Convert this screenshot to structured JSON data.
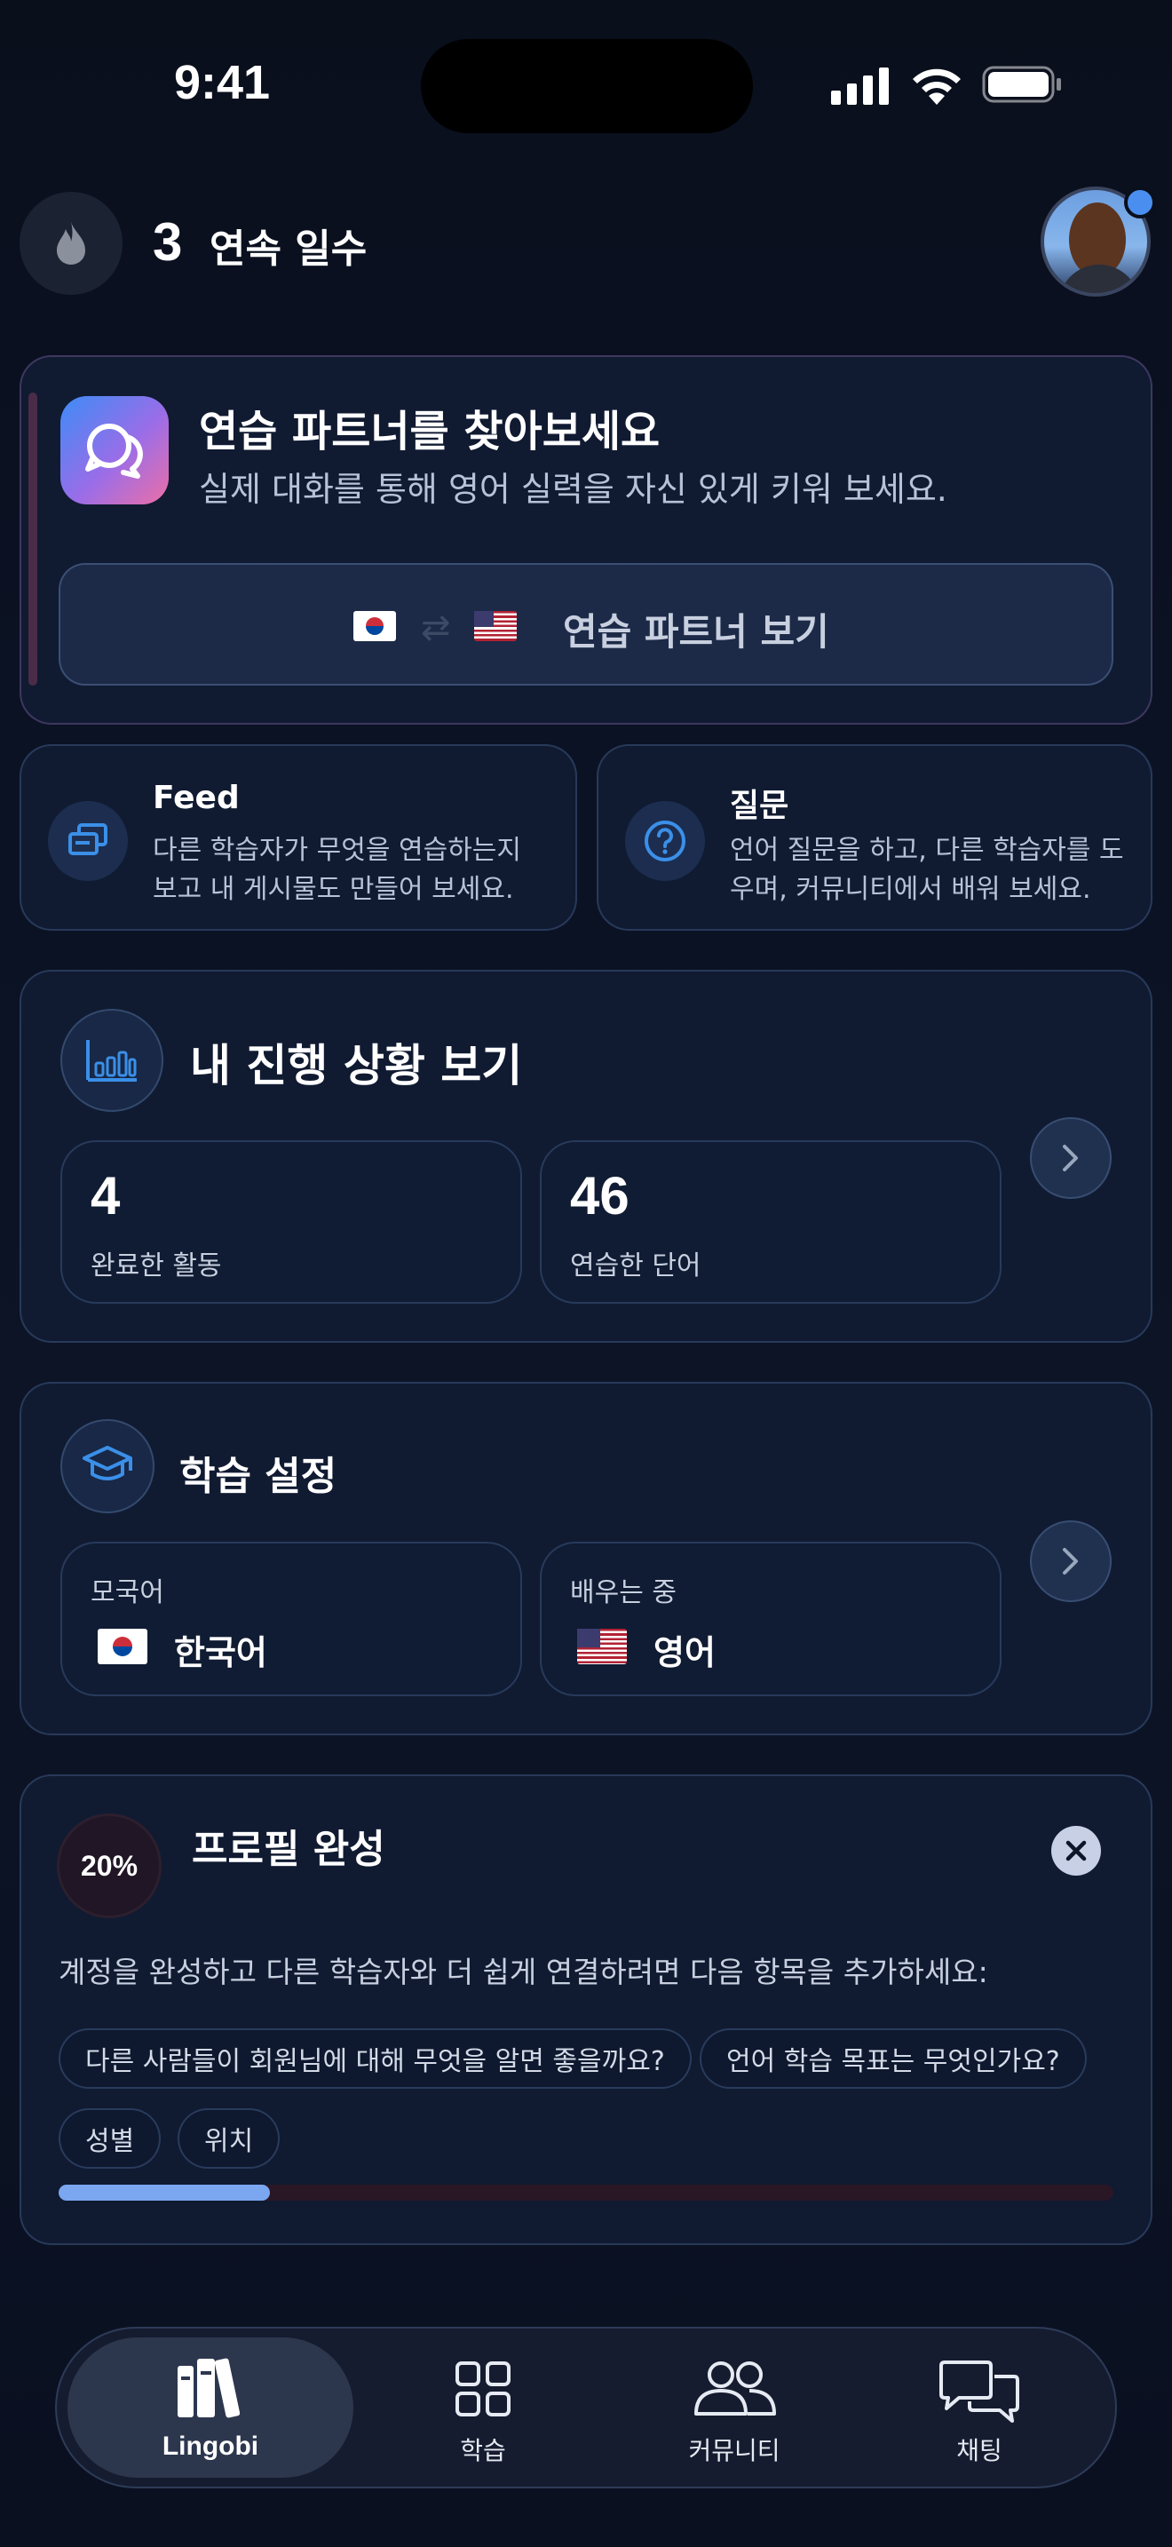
{
  "status_bar": {
    "time": "9:41"
  },
  "header": {
    "streak_count": "3",
    "streak_label": "연속 일수"
  },
  "partner_card": {
    "title": "연습 파트너를 찾아보세요",
    "subtitle": "실제 대화를 통해 영어 실력을 자신 있게 키워 보세요.",
    "button_label": "연습 파트너 보기"
  },
  "feed_card": {
    "title": "Feed",
    "desc_line1": "다른 학습자가 무엇을 연습하는지",
    "desc_line2": "보고 내 게시물도 만들어 보세요."
  },
  "question_card": {
    "title": "질문",
    "desc_line1": "언어 질문을 하고, 다른 학습자를 도",
    "desc_line2": "우며, 커뮤니티에서 배워 보세요."
  },
  "progress_card": {
    "title": "내 진행 상황 보기",
    "stats": [
      {
        "value": "4",
        "label": "완료한 활동"
      },
      {
        "value": "46",
        "label": "연습한 단어"
      }
    ]
  },
  "settings_card": {
    "title": "학습 설정",
    "native": {
      "label": "모국어",
      "value": "한국어"
    },
    "learning": {
      "label": "배우는 중",
      "value": "영어"
    }
  },
  "profile_card": {
    "percent_label": "20%",
    "progress_value": 0.2,
    "title": "프로필 완성",
    "description": "계정을 완성하고 다른 학습자와 더 쉽게 연결하려면 다음 항목을 추가하세요:",
    "chips": [
      "다른 사람들이 회원님에 대해 무엇을 알면 좋을까요?",
      "언어 학습 목표는 무엇인가요?",
      "성별",
      "위치"
    ]
  },
  "tab_bar": {
    "tabs": [
      {
        "label": "Lingobi",
        "icon": "books-icon",
        "active": true
      },
      {
        "label": "학습",
        "icon": "grid-icon",
        "active": false
      },
      {
        "label": "커뮤니티",
        "icon": "people-icon",
        "active": false
      },
      {
        "label": "채팅",
        "icon": "chat-bubbles-icon",
        "active": false
      }
    ]
  },
  "colors": {
    "accent": "#3b8fe8",
    "progress_fill": "#7aa7f0",
    "progress_track": "#3a1a2a",
    "unread_dot": "#4a8ff0"
  }
}
